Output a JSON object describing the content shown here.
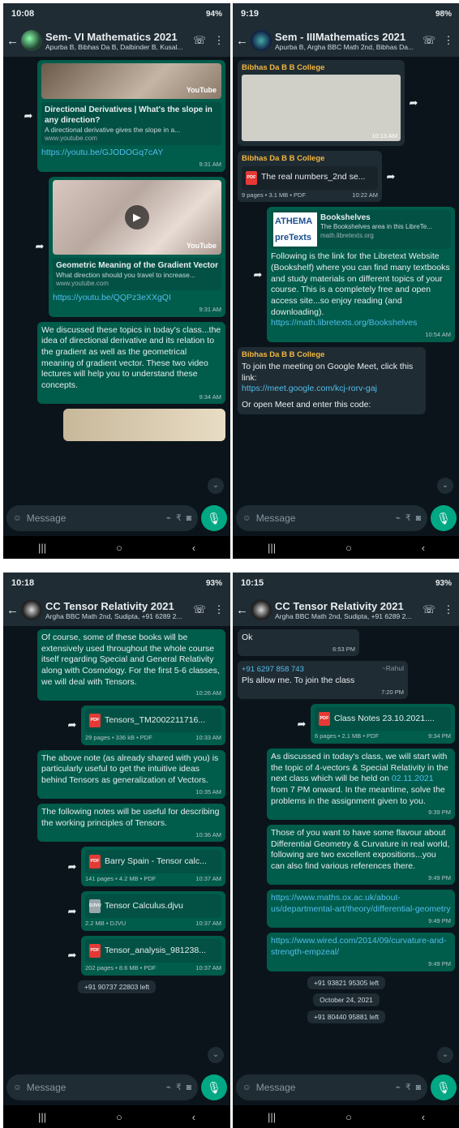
{
  "p0": {
    "sb": {
      "time": "10:08",
      "right": "94%"
    },
    "title": "Sem- VI Mathematics 2021",
    "members": "Apurba B, Bibhas Da B, Dalbinder B, Kusal...",
    "yt1": {
      "brand": "YouTube",
      "t": "Directional Derivatives | What's the slope in any direction?",
      "d": "A directional derivative gives the slope in a...",
      "s": "www.youtube.com",
      "url": "https://youtu.be/GJODOGq7cAY",
      "time": "9:31 AM"
    },
    "yt2": {
      "brand": "YouTube",
      "t": "Geometric Meaning of the Gradient Vector",
      "d": "What direction should you travel to increase...",
      "s": "www.youtube.com",
      "url": "https://youtu.be/QQPz3eXXgQI",
      "time": "9:31 AM"
    },
    "m3": {
      "text": "We discussed these topics in today's class...the idea of directional derivative and its relation to the gradient as well as the geometrical meaning of gradient vector. These two video lectures will help you to understand these concepts.",
      "time": "9:34 AM"
    }
  },
  "p1": {
    "sb": {
      "time": "9:19",
      "right": "98%"
    },
    "title": "Sem - IIIMathematics 2021",
    "members": "Apurba B, Argha BBC Math 2nd, Bibhas Da...",
    "m1": {
      "sender": "Bibhas Da B B College",
      "time": "10:13 AM"
    },
    "m2": {
      "sender": "Bibhas Da B B College",
      "file": "The real numbers_2nd se...",
      "meta": "9 pages • 3.1 MB • PDF",
      "time": "10:22 AM"
    },
    "m3": {
      "logo1": "ATHEMA",
      "logo2": "preTexts",
      "t": "Bookshelves",
      "d": "The Bookshelves area in this LibreTe...",
      "s": "math.libretexts.org",
      "text": "Following is the link for the Libretext Website (Bookshelf) where you can find many textbooks and study materials on different topics of your course. This is a completely free and open access site...so enjoy reading (and downloading).",
      "url": "https://math.libretexts.org/Bookshelves",
      "time": "10:54 AM"
    },
    "m4": {
      "sender": "Bibhas Da B B College",
      "text": "To join the meeting on Google Meet, click this link:",
      "url": "https://meet.google.com/kcj-rorv-gaj",
      "tail": "Or open Meet and enter this code:"
    }
  },
  "p2": {
    "sb": {
      "time": "10:18",
      "right": "93%"
    },
    "title": "CC Tensor Relativity 2021",
    "members": "Argha BBC Math 2nd, Sudipta, +91 6289 2...",
    "m1": {
      "text": "Of course, some of these books will be extensively used throughout the whole course itself regarding Special and General Relativity along with Cosmology. For the first 5-6 classes, we will deal with Tensors.",
      "time": "10:26 AM"
    },
    "m2": {
      "file": "Tensors_TM2002211716...",
      "meta": "29 pages • 336 kB • PDF",
      "time": "10:33 AM"
    },
    "m3": {
      "text": "The above note (as already shared with you) is particularly useful to get the intuitive ideas behind Tensors as generalization of Vectors.",
      "time": "10:35 AM"
    },
    "m4": {
      "text": "The following notes will be useful for describing the working principles of Tensors.",
      "time": "10:36 AM"
    },
    "m5": {
      "file": "Barry Spain - Tensor calc...",
      "meta": "141 pages • 4.2 MB • PDF",
      "time": "10:37 AM"
    },
    "m6": {
      "file": "Tensor Calculus.djvu",
      "meta": "2.2 MB • DJVU",
      "time": "10:37 AM"
    },
    "m7": {
      "file": "Tensor_analysis_981238...",
      "meta": "202 pages • 8.6 MB • PDF",
      "time": "10:37 AM"
    },
    "sys": "+91 90737 22803 left"
  },
  "p3": {
    "sb": {
      "time": "10:15",
      "right": "93%"
    },
    "title": "CC Tensor Relativity 2021",
    "members": "Argha BBC Math 2nd, Sudipta, +91 6289 2...",
    "m0": {
      "text": "Ok",
      "time": "6:53 PM"
    },
    "m1": {
      "num": "+91 6297 858 743",
      "tag": "~Rahul",
      "text": "Pls allow me. To join the class",
      "time": "7:20 PM"
    },
    "m2": {
      "file": "Class Notes 23.10.2021....",
      "meta": "6 pages • 2.1 MB • PDF",
      "time": "9:34 PM"
    },
    "m3": {
      "a": "As discussed in today's class, we will start with the topic of 4-vectors & Special Relativity in the next class which will be held on ",
      "date": "02.11.2021",
      "b": " from 7 PM onward. In the meantime, solve the problems in the assignment given to you.",
      "time": "9:39 PM"
    },
    "m4": {
      "text": "Those of you want to have some flavour about Differential Geometry & Curvature in real world, following are two excellent expositions...you can also find various references there.",
      "time": "9:49 PM"
    },
    "m5": {
      "url": "https://www.maths.ox.ac.uk/about-us/departmental-art/theory/differential-geometry",
      "time": "9:49 PM"
    },
    "m6": {
      "url": "https://www.wired.com/2014/09/curvature-and-strength-empzeal/",
      "time": "9:49 PM"
    },
    "sys1": "+91 93821 95305 left",
    "sys2": "October 24, 2021",
    "sys3": "+91 80440 95881 left"
  },
  "input": {
    "placeholder": "Message"
  },
  "pdf_label": "PDF",
  "djvu_label": "DJVU"
}
